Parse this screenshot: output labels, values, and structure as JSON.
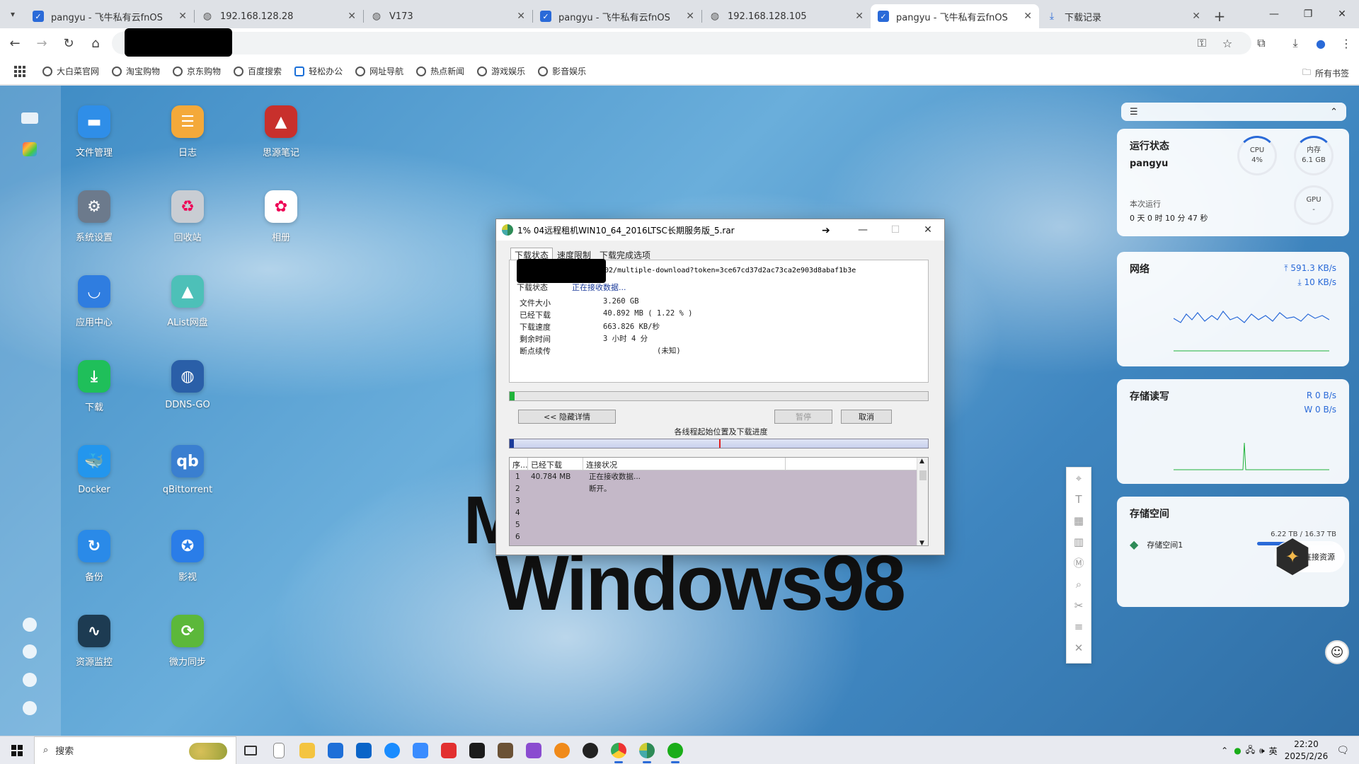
{
  "browser": {
    "tabs": [
      {
        "title": "pangyu - 飞牛私有云fnOS",
        "icon": "fnos-icon",
        "active": false
      },
      {
        "title": "192.168.128.28",
        "icon": "globe-icon",
        "active": false
      },
      {
        "title": "V173",
        "icon": "globe-icon",
        "active": false
      },
      {
        "title": "pangyu - 飞牛私有云fnOS",
        "icon": "fnos-icon",
        "active": false
      },
      {
        "title": "192.168.128.105",
        "icon": "globe-icon",
        "active": false
      },
      {
        "title": "pangyu - 飞牛私有云fnOS",
        "icon": "fnos-icon",
        "active": true
      },
      {
        "title": "下载记录",
        "icon": "download-icon",
        "active": false
      }
    ],
    "bookmarks": [
      "大白菜官网",
      "淘宝购物",
      "京东购物",
      "百度搜索",
      "轻松办公",
      "网址导航",
      "热点新闻",
      "游戏娱乐",
      "影音娱乐"
    ],
    "all_bookmarks": "所有书签"
  },
  "desktop": {
    "apps": [
      {
        "label": "文件管理",
        "icon": "folder-icon",
        "color": "#2f8ee8"
      },
      {
        "label": "日志",
        "icon": "log-icon",
        "color": "#f4a93a"
      },
      {
        "label": "思源笔记",
        "icon": "siyuan-icon",
        "color": "#c8302c"
      },
      {
        "label": "系统设置",
        "icon": "gear-icon",
        "color": "#6c7a8c"
      },
      {
        "label": "回收站",
        "icon": "recycle-icon",
        "color": "#c9cdd3"
      },
      {
        "label": "相册",
        "icon": "photos-icon",
        "color": "#ffffff"
      },
      {
        "label": "应用中心",
        "icon": "store-icon",
        "color": "#2f7de0"
      },
      {
        "label": "AList网盘",
        "icon": "alist-icon",
        "color": "#4dc0b8"
      },
      {
        "label": "下载",
        "icon": "download-icon",
        "color": "#1fbf5a"
      },
      {
        "label": "DDNS-GO",
        "icon": "ddns-icon",
        "color": "#2a5fa8"
      },
      {
        "label": "Docker",
        "icon": "docker-icon",
        "color": "#2396ed"
      },
      {
        "label": "qBittorrent",
        "icon": "qbittorrent-icon",
        "color": "#3a7fd0"
      },
      {
        "label": "备份",
        "icon": "backup-icon",
        "color": "#2a8ae8"
      },
      {
        "label": "影视",
        "icon": "video-icon",
        "color": "#2a7de8"
      },
      {
        "label": "资源监控",
        "icon": "monitor-icon",
        "color": "#1d3b52"
      },
      {
        "label": "微力同步",
        "icon": "sync-icon",
        "color": "#5cb83a"
      }
    ],
    "wallpaper_text_1": "M",
    "wallpaper_text_2": "Windows98"
  },
  "download_dialog": {
    "title": "1% 04远程租机WIN10_64_2016LTSC长期服务版_5.rar",
    "tabs": [
      "下载状态",
      "速度限制",
      "下载完成选项"
    ],
    "url": "002/multiple-download?token=3ce67cd37d2ac73ca2e903d8abaf1b3e",
    "rows": [
      {
        "key": "下载状态",
        "value": "正在接收数据..."
      },
      {
        "key": "文件大小",
        "value": "3.260  GB"
      },
      {
        "key": "已经下载",
        "value": "40.892  MB  ( 1.22 % )"
      },
      {
        "key": "下载速度",
        "value": "663.826  KB/秒"
      },
      {
        "key": "剩余时间",
        "value": "3 小时 4 分"
      },
      {
        "key": "断点续传",
        "value": "(未知)"
      }
    ],
    "progress": 0.0122,
    "buttons": {
      "details": "<< 隐藏详情",
      "pause": "暂停",
      "cancel": "取消"
    },
    "segments_label": "各线程起始位置及下载进度",
    "thread_columns": [
      "序...",
      "已经下载",
      "连接状况"
    ],
    "threads": [
      {
        "id": "1",
        "downloaded": "40.784 MB",
        "status": "正在接收数据..."
      },
      {
        "id": "2",
        "downloaded": "",
        "status": "断开。"
      },
      {
        "id": "3",
        "downloaded": "",
        "status": ""
      },
      {
        "id": "4",
        "downloaded": "",
        "status": ""
      },
      {
        "id": "5",
        "downloaded": "",
        "status": ""
      },
      {
        "id": "6",
        "downloaded": "",
        "status": ""
      }
    ]
  },
  "widgets": {
    "status": {
      "title": "运行状态",
      "host": "pangyu",
      "cpu_label": "CPU",
      "cpu_value": "4%",
      "mem_label": "内存",
      "mem_value": "6.1 GB",
      "gpu_label": "GPU",
      "gpu_value": "-",
      "uptime_label": "本次运行",
      "uptime_value": "0 天 0 时 10 分 47 秒"
    },
    "network": {
      "title": "网络",
      "up": "591.3 KB/s",
      "down": "10 KB/s"
    },
    "disk_io": {
      "title": "存储读写",
      "read": "R 0 B/s",
      "write": "W 0 B/s"
    },
    "storage": {
      "title": "存储空间",
      "name": "存储空间1",
      "usage": "6.22 TB / 16.37 TB",
      "fraction": 0.38
    },
    "connect_label": "连接资源"
  },
  "taskbar": {
    "search_placeholder": "搜索",
    "ime": "英",
    "time": "22:20",
    "date": "2025/2/26"
  },
  "colors": {
    "accent": "#2a6ad8",
    "progress": "#1fb33a"
  }
}
